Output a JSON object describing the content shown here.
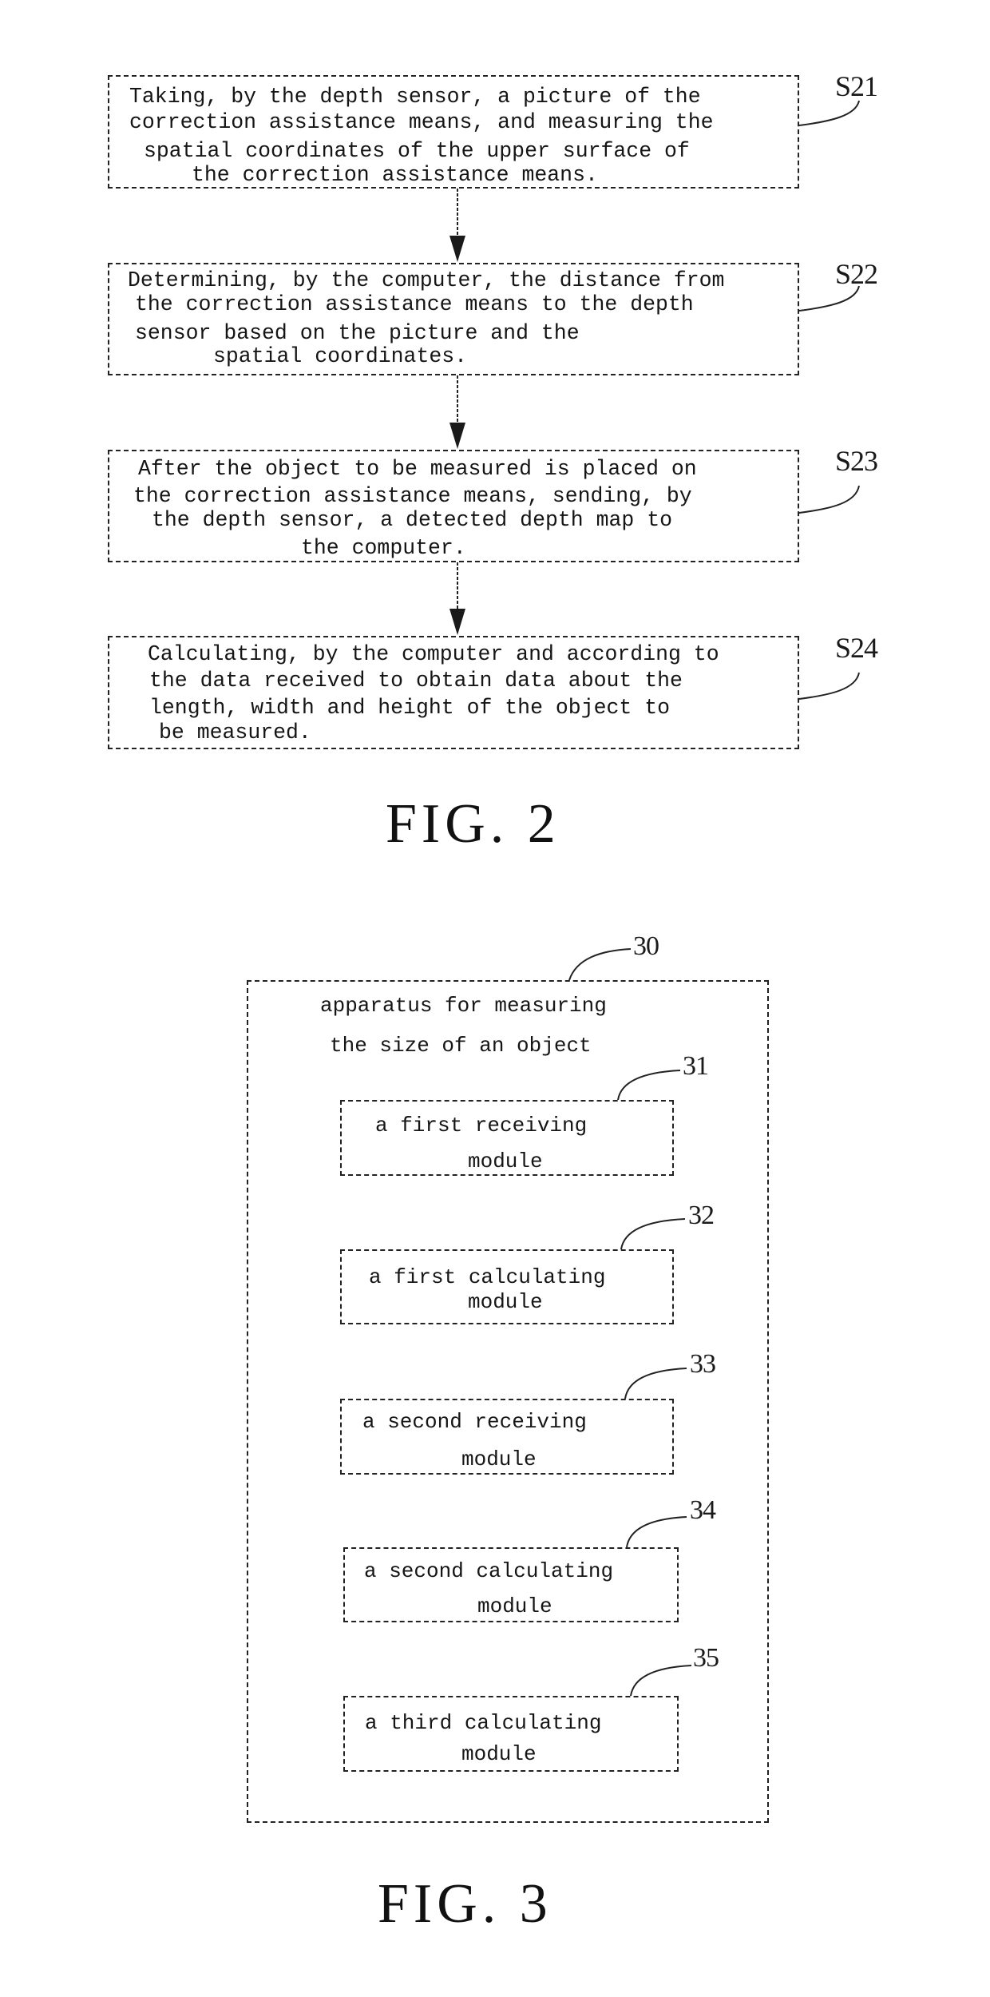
{
  "fig2": {
    "caption": "FIG. 2",
    "steps": [
      {
        "label": "S21",
        "lines": [
          "Taking, by the depth sensor, a picture of the",
          "correction assistance means, and measuring the",
          "spatial coordinates of the upper surface of",
          "the correction assistance means."
        ]
      },
      {
        "label": "S22",
        "lines": [
          "Determining, by the computer, the distance from",
          "the correction assistance means to the depth",
          "sensor based on the picture and the",
          "spatial coordinates."
        ]
      },
      {
        "label": "S23",
        "lines": [
          "After the object to be measured is placed on",
          "the correction assistance means, sending, by",
          "the depth sensor, a detected depth map to",
          "the computer."
        ]
      },
      {
        "label": "S24",
        "lines": [
          "Calculating, by the computer and according to",
          "the data received to obtain data about the",
          "length, width and height of the object to",
          "be measured."
        ]
      }
    ]
  },
  "fig3": {
    "caption": "FIG. 3",
    "apparatus": {
      "label": "30",
      "title_lines": [
        "apparatus for measuring",
        "the size of an object"
      ]
    },
    "modules": [
      {
        "label": "31",
        "lines": [
          "a first receiving",
          "module"
        ]
      },
      {
        "label": "32",
        "lines": [
          "a first calculating",
          "module"
        ]
      },
      {
        "label": "33",
        "lines": [
          "a second receiving",
          "module"
        ]
      },
      {
        "label": "34",
        "lines": [
          "a second calculating",
          "module"
        ]
      },
      {
        "label": "35",
        "lines": [
          "a third calculating",
          "module"
        ]
      }
    ]
  }
}
